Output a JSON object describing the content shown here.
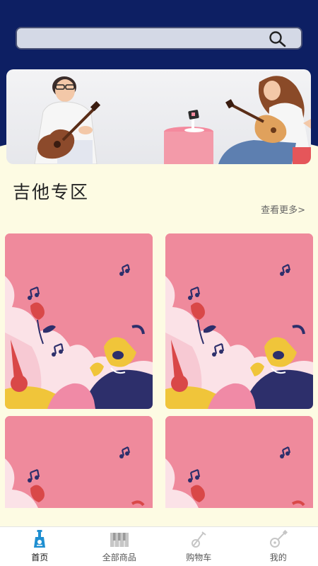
{
  "search": {
    "placeholder": ""
  },
  "section": {
    "title": "吉他专区",
    "more_label": "查看更多>"
  },
  "products": [
    {
      "image": "guitar-poster"
    },
    {
      "image": "guitar-poster"
    },
    {
      "image": "guitar-poster"
    },
    {
      "image": "guitar-poster"
    }
  ],
  "tabbar": {
    "items": [
      {
        "label": "首页",
        "icon": "guitar-home-icon",
        "active": true
      },
      {
        "label": "全部商品",
        "icon": "piano-icon",
        "active": false
      },
      {
        "label": "购物车",
        "icon": "guitar-cart-icon",
        "active": false
      },
      {
        "label": "我的",
        "icon": "guitar-profile-icon",
        "active": false
      }
    ]
  },
  "colors": {
    "header": "#0d1f63",
    "background": "#fdfbe3",
    "poster": "#ef8a9c",
    "active_tab": "#1f8fd1"
  }
}
